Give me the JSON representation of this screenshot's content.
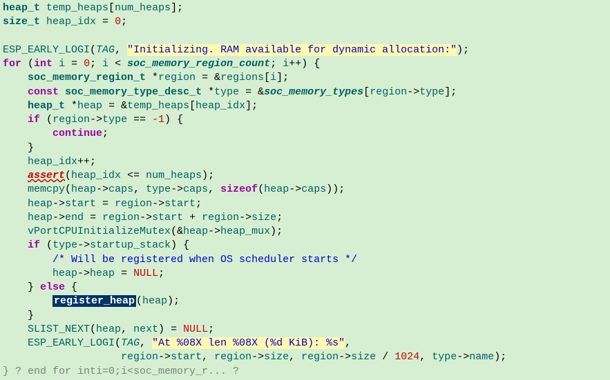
{
  "l1": {
    "a": "heap_t",
    "b": "temp_heaps",
    "c": "num_heaps"
  },
  "l2": {
    "a": "size_t",
    "b": "heap_idx",
    "c": "0"
  },
  "l3": {
    "a": "ESP_EARLY_LOGI",
    "b": "TAG",
    "c": "\"Initializing. RAM available for dynamic allocation:\""
  },
  "l4": {
    "a": "for",
    "b": "int",
    "c": "i",
    "d": "0",
    "e": "i",
    "f": "soc_memory_region_count",
    "g": "i"
  },
  "l5": {
    "a": "soc_memory_region_t",
    "b": "region",
    "c": "regions",
    "d": "i"
  },
  "l6": {
    "a": "const",
    "b": "soc_memory_type_desc_t",
    "c": "type",
    "d": "soc_memory_types",
    "e": "region",
    "f": "type"
  },
  "l7": {
    "a": "heap_t",
    "b": "heap",
    "c": "temp_heaps",
    "d": "heap_idx"
  },
  "l8": {
    "a": "if",
    "b": "region",
    "c": "type",
    "d": "-1"
  },
  "l9": {
    "a": "continue"
  },
  "l10": {
    "a": "heap_idx"
  },
  "l11": {
    "a": "assert",
    "b": "heap_idx",
    "c": "num_heaps"
  },
  "l12": {
    "a": "memcpy",
    "b": "heap",
    "c": "caps",
    "d": "type",
    "e": "caps",
    "f": "sizeof",
    "g": "heap",
    "h": "caps"
  },
  "l13": {
    "a": "heap",
    "b": "start",
    "c": "region",
    "d": "start"
  },
  "l14": {
    "a": "heap",
    "b": "end",
    "c": "region",
    "d": "start",
    "e": "region",
    "f": "size"
  },
  "l15": {
    "a": "vPortCPUInitializeMutex",
    "b": "heap",
    "c": "heap_mux"
  },
  "l16": {
    "a": "if",
    "b": "type",
    "c": "startup_stack"
  },
  "l17": {
    "a": "/* Will be registered when OS scheduler starts */"
  },
  "l18": {
    "a": "heap",
    "b": "heap",
    "c": "NULL"
  },
  "l19": {
    "a": "else"
  },
  "l20": {
    "a": "register_heap",
    "b": "heap"
  },
  "l21": {
    "a": "SLIST_NEXT",
    "b": "heap",
    "c": "next",
    "d": "NULL"
  },
  "l22": {
    "a": "ESP_EARLY_LOGI",
    "b": "TAG",
    "c": "\"At %08X len %08X (%d KiB): %s\""
  },
  "l23": {
    "a": "region",
    "b": "start",
    "c": "region",
    "d": "size",
    "e": "region",
    "f": "size",
    "g": "1024",
    "h": "type",
    "i": "name"
  },
  "l24": {
    "a": "} ? end for inti=0;i<soc_memory_r... ?"
  }
}
